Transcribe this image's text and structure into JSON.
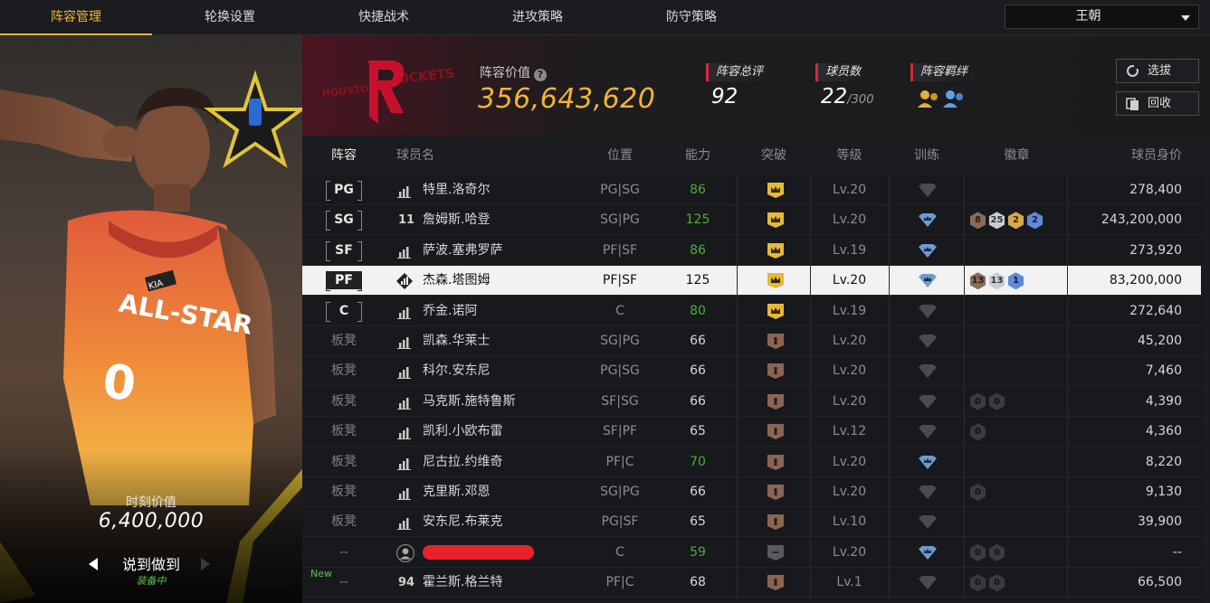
{
  "nav": {
    "tabs": [
      "阵容管理",
      "轮换设置",
      "快捷战术",
      "进攻策略",
      "防守策略"
    ],
    "active_index": 0,
    "team_select": "王朝"
  },
  "card": {
    "moment_label": "时刻价值",
    "moment_value": "6,400,000",
    "card_name": "说到做到",
    "status": "装备中",
    "jersey_text": "ALL-STAR",
    "jersey_number": "0",
    "sponsor_text": "KIA"
  },
  "team": {
    "logo_text": "ROCKETS",
    "logo_small": "HOUSTON",
    "value_label": "阵容价值",
    "value": "356,643,620",
    "overall_label": "阵容总评",
    "overall": "92",
    "players_label": "球员数",
    "players": "22",
    "players_max": "/300",
    "bond_label": "阵容羁绊",
    "pick_label": "选拔",
    "recycle_label": "回收"
  },
  "table": {
    "headers": {
      "lineup": "阵容",
      "name": "球员名",
      "position": "位置",
      "ability": "能力",
      "breakthrough": "突破",
      "level": "等级",
      "training": "训练",
      "badges": "徽章",
      "value": "球员身价"
    },
    "rows": [
      {
        "slot": "PG",
        "bench": false,
        "icon": "bars",
        "name": "特里.洛奇尔",
        "pos": "PG|SG",
        "ability": "86",
        "green": true,
        "brk": "gold",
        "level": "Lv.20",
        "train": "grey",
        "badges": [],
        "price": "278,400"
      },
      {
        "slot": "SG",
        "bench": false,
        "icon": "jersey",
        "jersey": "11",
        "name": "詹姆斯.哈登",
        "pos": "SG|PG",
        "ability": "125",
        "green": true,
        "brk": "gold",
        "level": "Lv.20",
        "train": "blue",
        "badges": [
          {
            "t": "bronze",
            "v": "8"
          },
          {
            "t": "silver",
            "v": "25"
          },
          {
            "t": "gold",
            "v": "2"
          },
          {
            "t": "blue",
            "v": "2"
          }
        ],
        "price": "243,200,000"
      },
      {
        "slot": "SF",
        "bench": false,
        "icon": "bars",
        "name": "萨波.塞弗罗萨",
        "pos": "PF|SF",
        "ability": "86",
        "green": true,
        "brk": "gold",
        "level": "Lv.19",
        "train": "blue",
        "badges": [],
        "price": "273,920"
      },
      {
        "slot": "PF",
        "bench": false,
        "icon": "diamond",
        "name": "杰森.塔图姆",
        "pos": "PF|SF",
        "ability": "125",
        "green": false,
        "brk": "gold",
        "level": "Lv.20",
        "train": "blue",
        "badges": [
          {
            "t": "bronze",
            "v": "13"
          },
          {
            "t": "silver",
            "v": "13"
          },
          {
            "t": "blue",
            "v": "1"
          }
        ],
        "price": "83,200,000",
        "selected": true
      },
      {
        "slot": "C",
        "bench": false,
        "icon": "bars",
        "name": "乔金.诺阿",
        "pos": "C",
        "ability": "80",
        "green": true,
        "brk": "gold",
        "level": "Lv.19",
        "train": "grey",
        "badges": [],
        "price": "272,640"
      },
      {
        "slot": "板凳",
        "bench": true,
        "icon": "bars",
        "name": "凯森.华莱士",
        "pos": "SG|PG",
        "ability": "66",
        "green": false,
        "brk": "bronze",
        "level": "Lv.20",
        "train": "grey",
        "badges": [],
        "price": "45,200"
      },
      {
        "slot": "板凳",
        "bench": true,
        "icon": "bars",
        "name": "科尔.安东尼",
        "pos": "PG|SG",
        "ability": "66",
        "green": false,
        "brk": "bronze",
        "level": "Lv.20",
        "train": "grey",
        "badges": [],
        "price": "7,460"
      },
      {
        "slot": "板凳",
        "bench": true,
        "icon": "bars",
        "name": "马克斯.施特鲁斯",
        "pos": "SF|SG",
        "ability": "66",
        "green": false,
        "brk": "bronze",
        "level": "Lv.20",
        "train": "grey",
        "badges": [
          {
            "t": "empty",
            "v": "0"
          },
          {
            "t": "empty",
            "v": "0"
          }
        ],
        "price": "4,390"
      },
      {
        "slot": "板凳",
        "bench": true,
        "icon": "bars",
        "name": "凯利.小欧布雷",
        "pos": "SF|PF",
        "ability": "65",
        "green": false,
        "brk": "bronze",
        "level": "Lv.12",
        "train": "grey",
        "badges": [
          {
            "t": "empty",
            "v": "0"
          }
        ],
        "price": "4,360"
      },
      {
        "slot": "板凳",
        "bench": true,
        "icon": "bars",
        "name": "尼古拉.约维奇",
        "pos": "PF|C",
        "ability": "70",
        "green": true,
        "brk": "bronze",
        "level": "Lv.20",
        "train": "blue",
        "badges": [],
        "price": "8,220"
      },
      {
        "slot": "板凳",
        "bench": true,
        "icon": "bars",
        "name": "克里斯.邓恩",
        "pos": "SG|PG",
        "ability": "66",
        "green": false,
        "brk": "bronze",
        "level": "Lv.20",
        "train": "grey",
        "badges": [
          {
            "t": "empty",
            "v": "0"
          }
        ],
        "price": "9,130"
      },
      {
        "slot": "板凳",
        "bench": true,
        "icon": "bars",
        "name": "安东尼.布莱克",
        "pos": "PG|SF",
        "ability": "65",
        "green": false,
        "brk": "bronze",
        "level": "Lv.10",
        "train": "grey",
        "badges": [],
        "price": "39,900"
      },
      {
        "slot": "--",
        "bench": true,
        "icon": "avatar",
        "name": "",
        "redacted": true,
        "pos": "C",
        "ability": "59",
        "green": true,
        "brk": "grey",
        "level": "Lv.20",
        "train": "blue",
        "badges": [
          {
            "t": "empty",
            "v": "0"
          },
          {
            "t": "empty",
            "v": "0"
          }
        ],
        "price": "--"
      },
      {
        "slot": "--",
        "bench": true,
        "new": "New",
        "icon": "jersey",
        "jersey": "94",
        "name": "霍兰斯.格兰特",
        "pos": "PF|C",
        "ability": "68",
        "green": false,
        "brk": "bronze",
        "level": "Lv.1",
        "train": "grey",
        "badges": [
          {
            "t": "empty",
            "v": "0"
          },
          {
            "t": "empty",
            "v": "0"
          }
        ],
        "price": "66,500"
      }
    ]
  },
  "colors": {
    "accent": "#f0b534",
    "green": "#4cae3a",
    "rockets_red": "#c8102e",
    "tag_red": "#d32b36"
  }
}
